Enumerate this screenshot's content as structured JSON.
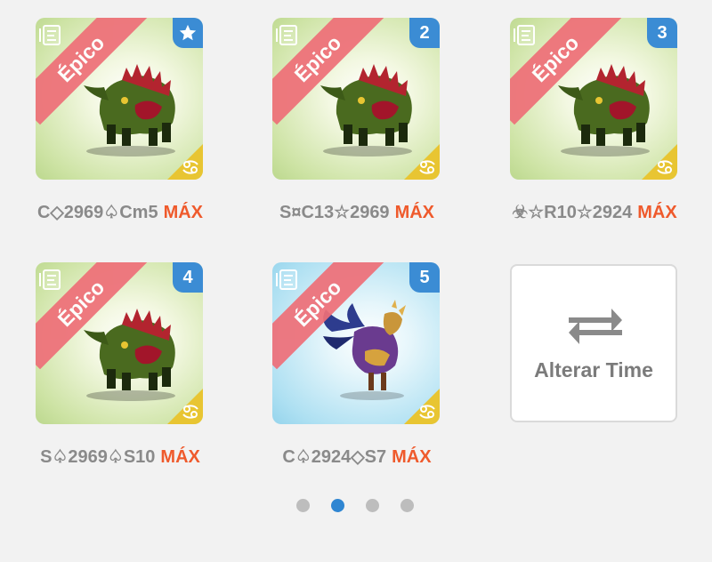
{
  "cards": [
    {
      "rarity": "Épico",
      "badge": "",
      "badge_icon": "star-icon",
      "caption": "C◇2969♤Cm5",
      "max": "MÁX",
      "theme": "green"
    },
    {
      "rarity": "Épico",
      "badge": "2",
      "caption": "S¤C13☆2969",
      "max": "MÁX",
      "theme": "green"
    },
    {
      "rarity": "Épico",
      "badge": "3",
      "caption": "☣☆R10☆2924",
      "max": "MÁX",
      "theme": "green"
    },
    {
      "rarity": "Épico",
      "badge": "4",
      "caption": "S♤2969♤S10",
      "max": "MÁX",
      "theme": "green"
    },
    {
      "rarity": "Épico",
      "badge": "5",
      "caption": "C♤2924◇S7",
      "max": "MÁX",
      "theme": "blue"
    }
  ],
  "swap_button": {
    "label": "Alterar Time",
    "icon": "swap-arrows-icon"
  },
  "pagination": {
    "pages": 4,
    "active": 2
  },
  "colors": {
    "rarity_ribbon": "#ee6f78",
    "badge": "#3b8cd4",
    "zodiac": "#e8c532",
    "max": "#ef5a2c",
    "active_dot": "#2f86d2"
  }
}
